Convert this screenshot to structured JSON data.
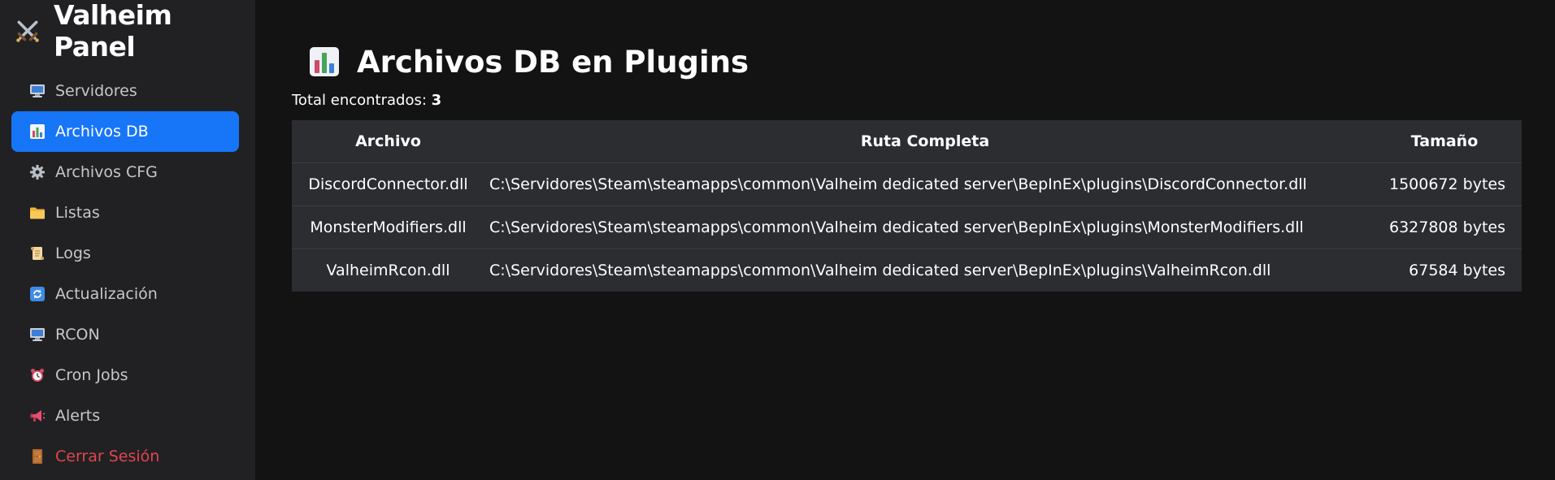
{
  "sidebar": {
    "brand_title": "Valheim Panel",
    "brand_icon": "crossed-swords-icon",
    "items": [
      {
        "label": "Servidores",
        "icon": "desktop-computer-icon",
        "active": false
      },
      {
        "label": "Archivos DB",
        "icon": "bar-chart-icon",
        "active": true
      },
      {
        "label": "Archivos CFG",
        "icon": "gear-icon",
        "active": false
      },
      {
        "label": "Listas",
        "icon": "folder-icon",
        "active": false
      },
      {
        "label": "Logs",
        "icon": "scroll-icon",
        "active": false
      },
      {
        "label": "Actualización",
        "icon": "refresh-icon",
        "active": false
      },
      {
        "label": "RCON",
        "icon": "desktop-computer-icon",
        "active": false
      },
      {
        "label": "Cron Jobs",
        "icon": "alarm-clock-icon",
        "active": false
      },
      {
        "label": "Alerts",
        "icon": "megaphone-icon",
        "active": false
      },
      {
        "label": "Cerrar Sesión",
        "icon": "door-icon",
        "active": false
      }
    ]
  },
  "main": {
    "title": "Archivos DB en Plugins",
    "title_icon": "bar-chart-icon",
    "total_label": "Total encontrados:",
    "total_value": "3",
    "table": {
      "headers": [
        "Archivo",
        "Ruta Completa",
        "Tamaño"
      ],
      "rows": [
        {
          "name": "DiscordConnector.dll",
          "path": "C:\\Servidores\\Steam\\steamapps\\common\\Valheim dedicated server\\BepInEx\\plugins\\DiscordConnector.dll",
          "size": "1500672 bytes"
        },
        {
          "name": "MonsterModifiers.dll",
          "path": "C:\\Servidores\\Steam\\steamapps\\common\\Valheim dedicated server\\BepInEx\\plugins\\MonsterModifiers.dll",
          "size": "6327808 bytes"
        },
        {
          "name": "ValheimRcon.dll",
          "path": "C:\\Servidores\\Steam\\steamapps\\common\\Valheim dedicated server\\BepInEx\\plugins\\ValheimRcon.dll",
          "size": "67584 bytes"
        }
      ]
    }
  },
  "colors": {
    "sidebar_bg": "#212123",
    "main_bg": "#131313",
    "active_bg": "#1775f8",
    "danger": "#e0464e",
    "table_bg": "#2b2d31"
  }
}
